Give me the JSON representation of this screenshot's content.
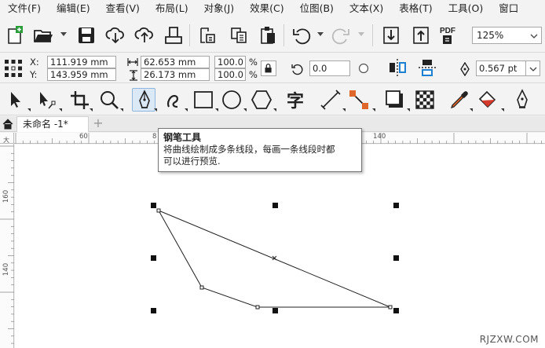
{
  "menu": [
    "文件(F)",
    "编辑(E)",
    "查看(V)",
    "布局(L)",
    "对象(J)",
    "效果(C)",
    "位图(B)",
    "文本(X)",
    "表格(T)",
    "工具(O)",
    "窗口"
  ],
  "toolbar": {
    "zoom_value": "125%",
    "pdf_label": "PDF"
  },
  "props": {
    "x_label": "X:",
    "y_label": "Y:",
    "x_value": "111.919 mm",
    "y_value": "143.959 mm",
    "w_value": "62.653 mm",
    "h_value": "26.173 mm",
    "scale_w": "100.0",
    "scale_h": "100.0",
    "percent": "%",
    "rotation": "0.0",
    "outline_width": "0.567 pt"
  },
  "tools": {
    "text_tool_glyph": "字"
  },
  "document": {
    "tab_title": "未命名 -1*",
    "new_tab": "+"
  },
  "ruler": {
    "h_labels": [
      "60",
      "8",
      "140"
    ],
    "v_labels": [
      "大",
      "160",
      "140"
    ]
  },
  "tooltip": {
    "title": "钢笔工具",
    "line1": "将曲线绘制成多条线段，每画一条线段时都",
    "line2": "可以进行预览."
  },
  "watermark": "RJZXW.COM"
}
